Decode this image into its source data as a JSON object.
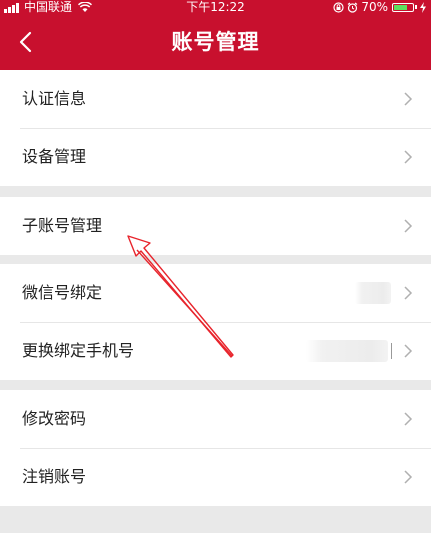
{
  "status_bar": {
    "carrier": "中国联通",
    "time": "下午12:22",
    "battery": "70%",
    "battery_level": 0.7
  },
  "nav": {
    "title": "账号管理",
    "back_icon": "chevron-left-icon"
  },
  "groups": [
    {
      "items": [
        {
          "label": "认证信息"
        },
        {
          "label": "设备管理"
        }
      ]
    },
    {
      "items": [
        {
          "label": "子账号管理"
        }
      ]
    },
    {
      "items": [
        {
          "label": "微信号绑定",
          "value": ""
        },
        {
          "label": "更换绑定手机号",
          "value": ""
        }
      ]
    },
    {
      "items": [
        {
          "label": "修改密码"
        },
        {
          "label": "注销账号"
        }
      ]
    }
  ],
  "colors": {
    "brand": "#c8102e",
    "background": "#e9e9e9",
    "annotation_arrow": "#e8242c"
  }
}
